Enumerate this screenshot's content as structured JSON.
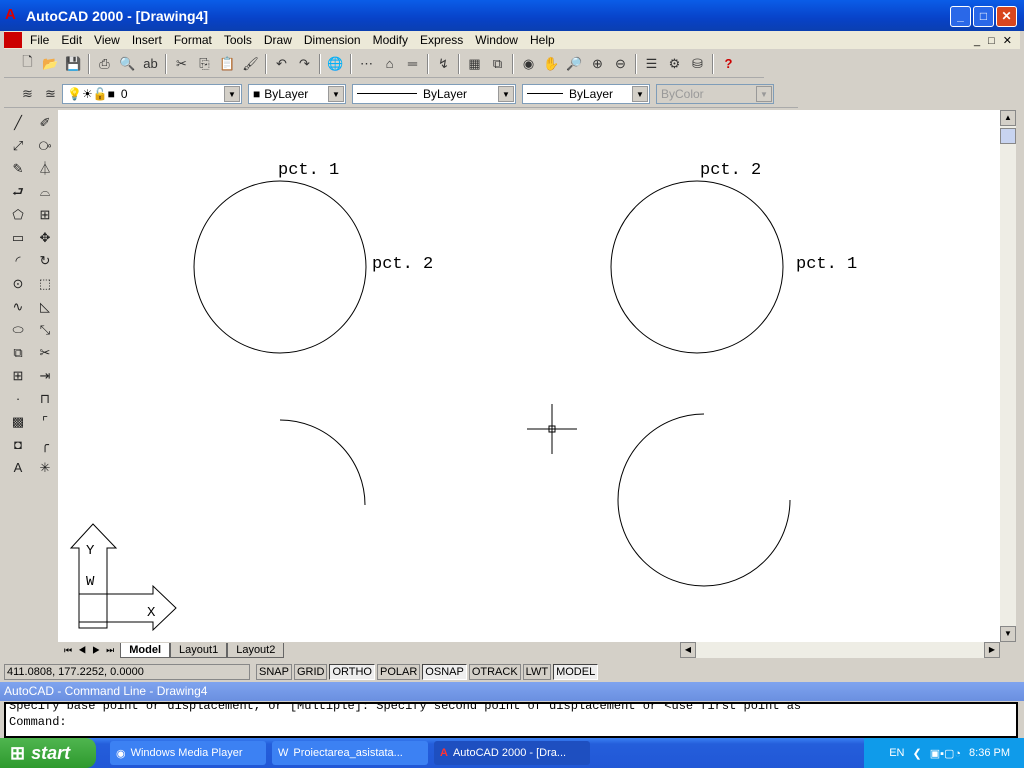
{
  "window": {
    "title": "AutoCAD 2000 - [Drawing4]",
    "controls": [
      "minimize",
      "maximize",
      "close"
    ]
  },
  "menu": [
    "File",
    "Edit",
    "View",
    "Insert",
    "Format",
    "Tools",
    "Draw",
    "Dimension",
    "Modify",
    "Express",
    "Window",
    "Help"
  ],
  "properties": {
    "layer": "0",
    "color": "ByLayer",
    "linetype": "ByLayer",
    "lineweight": "ByLayer",
    "plotstyle": "ByColor"
  },
  "drawing": {
    "labels": [
      "pct. 1",
      "pct. 2",
      "pct. 2",
      "pct. 1"
    ],
    "ucs": {
      "y": "Y",
      "w": "W",
      "x": "X"
    }
  },
  "tabs": [
    "Model",
    "Layout1",
    "Layout2"
  ],
  "status": {
    "coords": "411.0808, 177.2252, 0.0000",
    "toggles": [
      {
        "label": "SNAP",
        "on": false
      },
      {
        "label": "GRID",
        "on": false
      },
      {
        "label": "ORTHO",
        "on": true
      },
      {
        "label": "POLAR",
        "on": false
      },
      {
        "label": "OSNAP",
        "on": true
      },
      {
        "label": "OTRACK",
        "on": false
      },
      {
        "label": "LWT",
        "on": false
      },
      {
        "label": "MODEL",
        "on": true
      }
    ]
  },
  "command": {
    "title": "AutoCAD - Command Line - Drawing4",
    "history": "Specify base point or displacement, or [Multiple]: Specify second point of displacement or <use first point as",
    "prompt": "Command:"
  },
  "taskbar": {
    "start": "start",
    "tasks": [
      "Windows Media Player",
      "Proiectarea_asistata...",
      "AutoCAD 2000 - [Dra..."
    ],
    "lang": "EN",
    "time": "8:36 PM"
  }
}
